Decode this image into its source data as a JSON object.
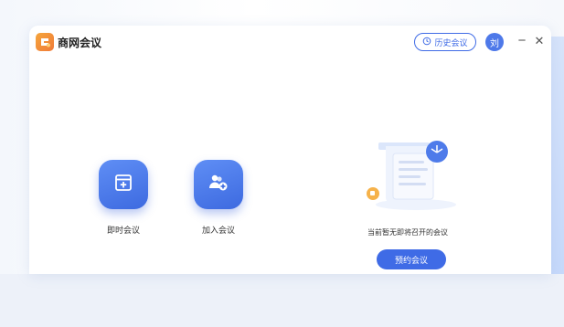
{
  "app": {
    "title": "商网会议"
  },
  "header": {
    "history_label": "历史会议",
    "avatar_text": "刘",
    "minimize": "−",
    "close": "✕"
  },
  "actions": [
    {
      "label": "即时会议",
      "icon": "instant-meeting-icon"
    },
    {
      "label": "加入会议",
      "icon": "join-meeting-icon"
    }
  ],
  "empty_state": {
    "message": "当前暂无即将召开的会议",
    "schedule_label": "预约会议"
  },
  "colors": {
    "accent": "#3f6be6",
    "logo": "#f5a53b",
    "avatar": "#4e79e9"
  }
}
